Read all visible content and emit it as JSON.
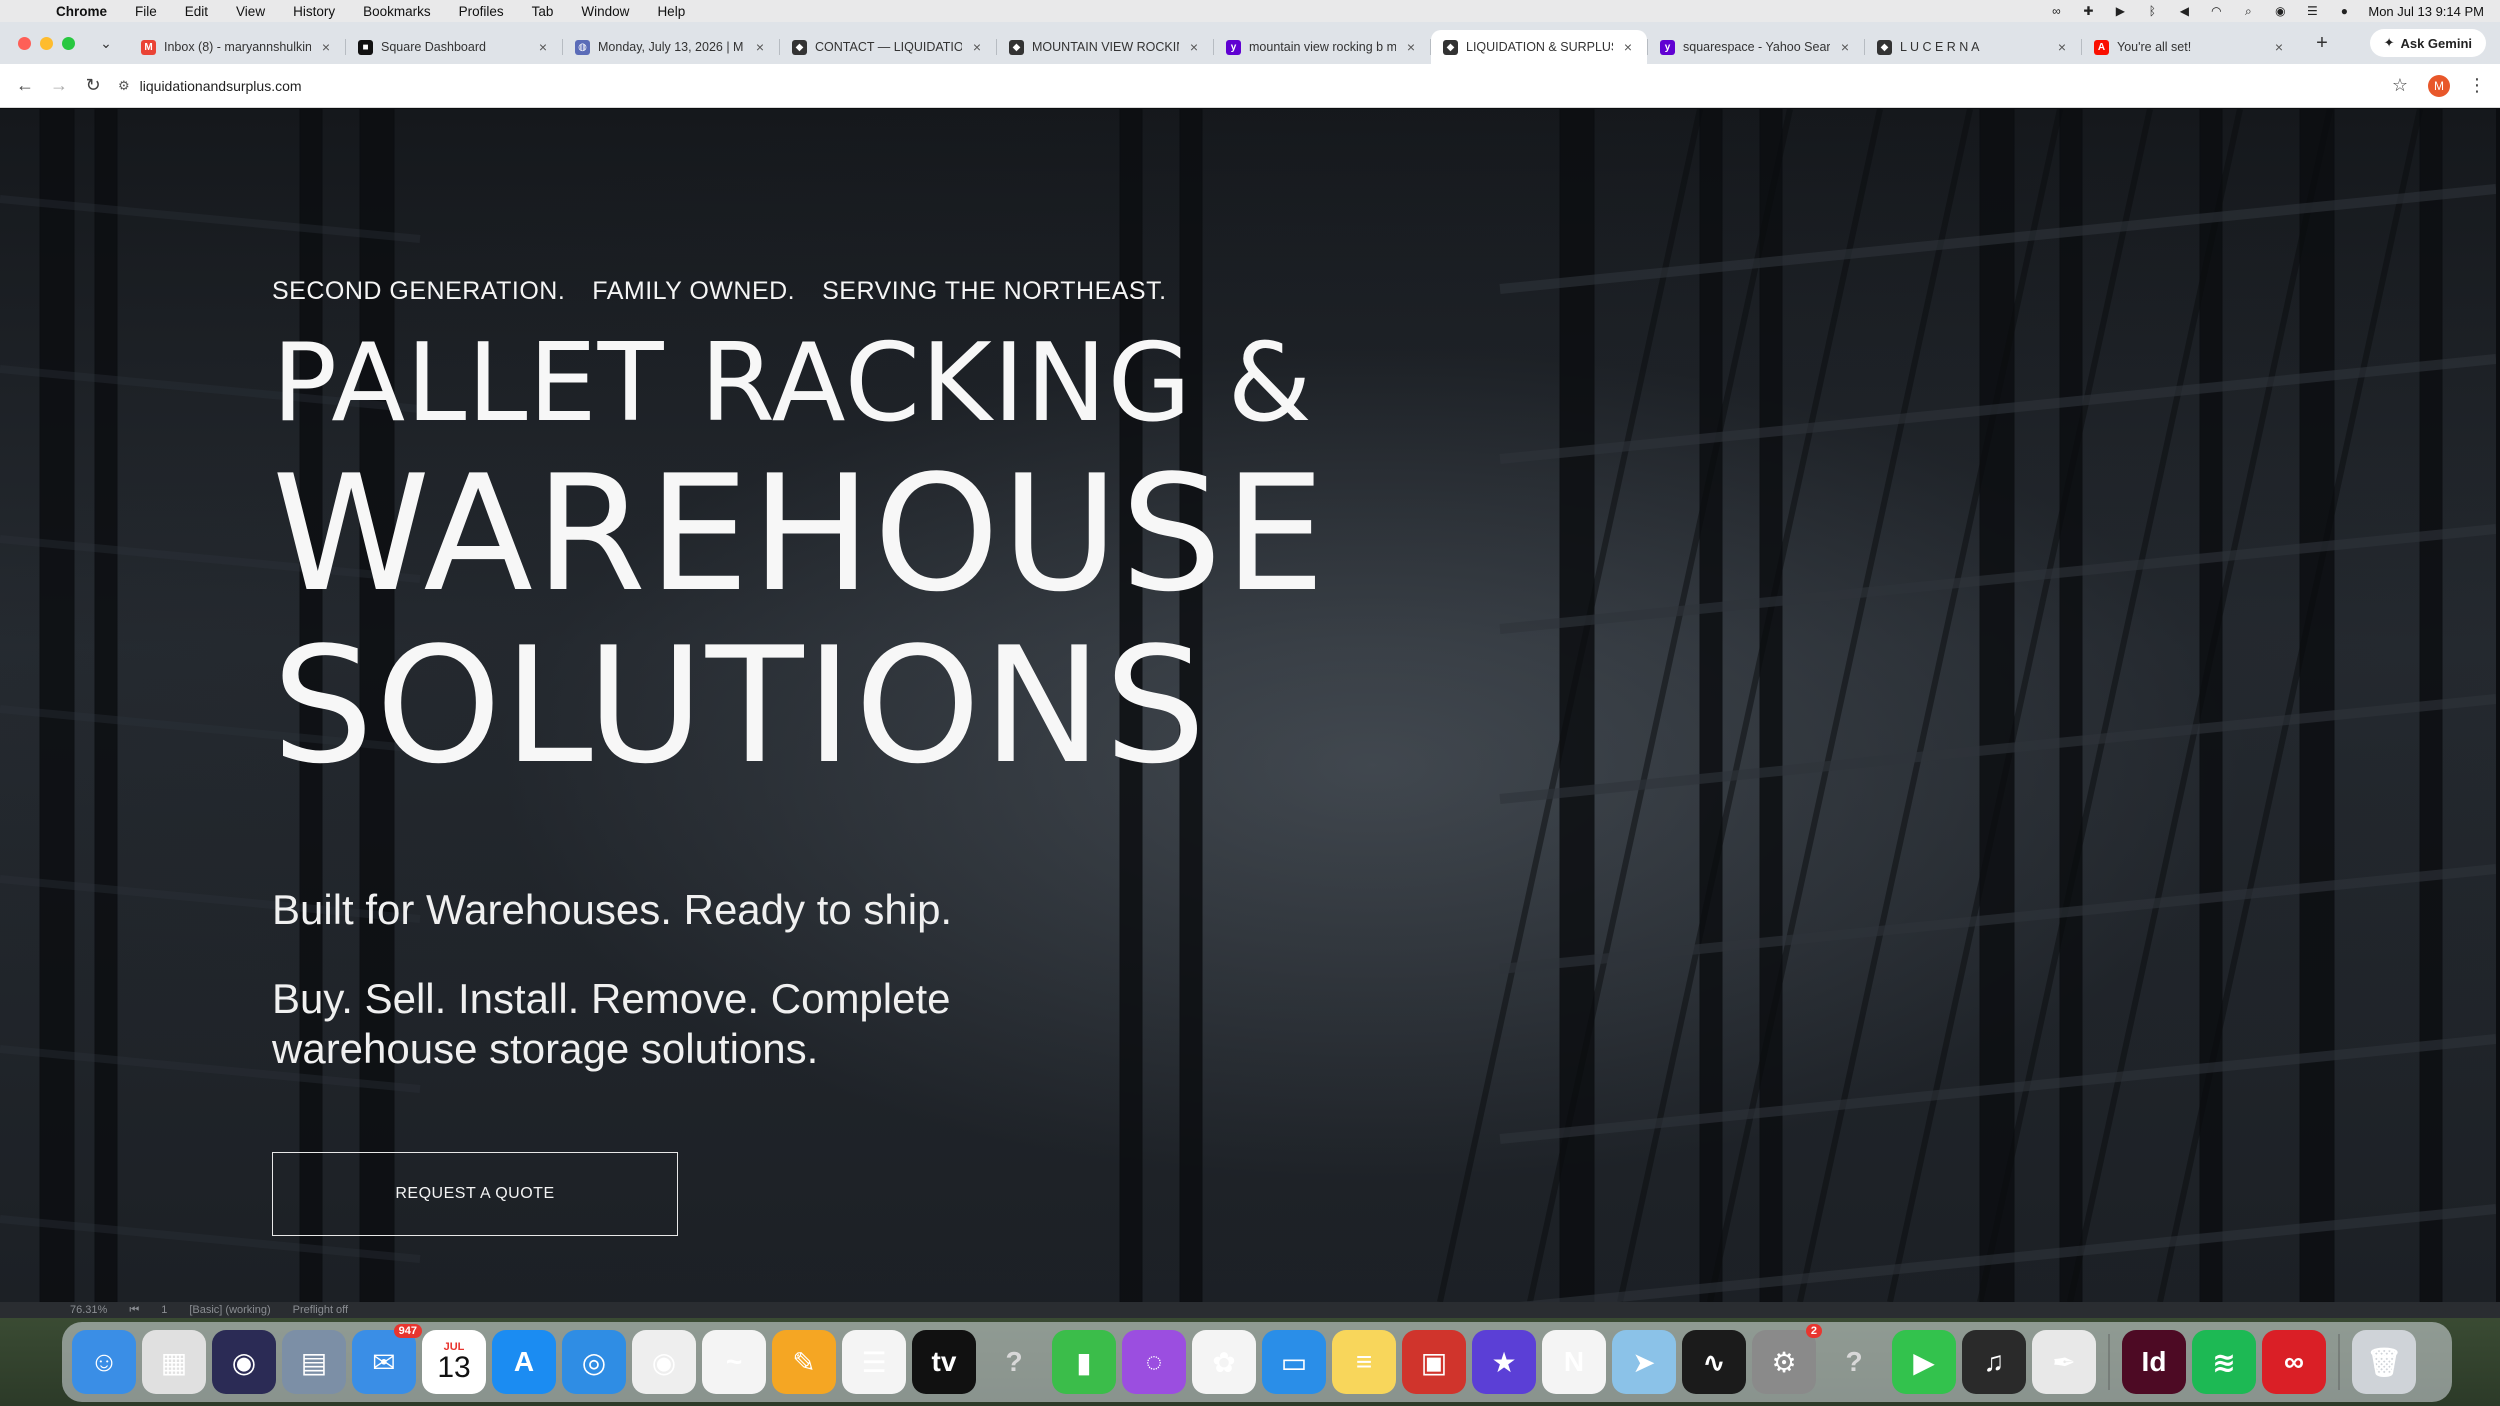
{
  "menubar": {
    "app": "Chrome",
    "items": [
      "File",
      "Edit",
      "View",
      "History",
      "Bookmarks",
      "Profiles",
      "Tab",
      "Window",
      "Help"
    ],
    "clock": "Mon Jul 13  9:14 PM"
  },
  "tabs": [
    {
      "title": "Inbox (8) - maryannshulkin",
      "favicon": "gmail-icon",
      "color": "#ea4335",
      "glyph": "M",
      "active": false
    },
    {
      "title": "Square Dashboard",
      "favicon": "square-icon",
      "color": "#111111",
      "glyph": "■",
      "active": false
    },
    {
      "title": "Monday, July 13, 2026 | M",
      "favicon": "globe-icon",
      "color": "#5b6cb8",
      "glyph": "◍",
      "active": false
    },
    {
      "title": "CONTACT — LIQUIDATION",
      "favicon": "squarespace-icon",
      "color": "#333333",
      "glyph": "◆",
      "active": false
    },
    {
      "title": "MOUNTAIN VIEW ROCKING",
      "favicon": "squarespace-icon",
      "color": "#333333",
      "glyph": "◆",
      "active": false
    },
    {
      "title": "mountain view rocking b m",
      "favicon": "yahoo-icon",
      "color": "#6001d2",
      "glyph": "y",
      "active": false
    },
    {
      "title": "LIQUIDATION & SURPLUS",
      "favicon": "squarespace-icon",
      "color": "#333333",
      "glyph": "◆",
      "active": true
    },
    {
      "title": "squarespace - Yahoo Sear",
      "favicon": "yahoo-icon",
      "color": "#6001d2",
      "glyph": "y",
      "active": false
    },
    {
      "title": "L U C E R N A",
      "favicon": "squarespace-icon",
      "color": "#333333",
      "glyph": "◆",
      "active": false
    },
    {
      "title": "You're all set!",
      "favicon": "adobe-icon",
      "color": "#fa0f00",
      "glyph": "A",
      "active": false
    }
  ],
  "toolbar": {
    "gemini": "Ask Gemini",
    "url": "liquidationandsurplus.com",
    "avatar_letter": "M"
  },
  "hero": {
    "kicker": [
      "SECOND GENERATION.",
      "FAMILY OWNED.",
      "SERVING THE NORTHEAST."
    ],
    "line1": "PALLET RACKING &",
    "line2": "WAREHOUSE",
    "line3": "SOLUTIONS",
    "sub1": "Built for Warehouses. Ready to ship.",
    "sub2": "Buy. Sell. Install. Remove. Complete warehouse storage solutions.",
    "cta": "REQUEST A QUOTE"
  },
  "appstrip": {
    "zoom": "76.31%",
    "page": "1",
    "workspace": "[Basic] (working)",
    "preflight": "Preflight off"
  },
  "dock": [
    {
      "name": "finder-icon",
      "color": "#3a8ee6",
      "glyph": "☺"
    },
    {
      "name": "launchpad-icon",
      "color": "#e0e0e0",
      "glyph": "▦"
    },
    {
      "name": "siri-icon",
      "color": "#2b2b55",
      "glyph": "◉"
    },
    {
      "name": "preview-icon",
      "color": "#7c8fa6",
      "glyph": "▤"
    },
    {
      "name": "mail-icon",
      "color": "#3a8ee6",
      "glyph": "✉",
      "badge": "947"
    },
    {
      "name": "calendar-icon",
      "color": "#ffffff",
      "glyph": "",
      "cal_month": "JUL",
      "cal_day": "13"
    },
    {
      "name": "app-store-icon",
      "color": "#1b8cf2",
      "glyph": "A"
    },
    {
      "name": "safari-icon",
      "color": "#2f8de4",
      "glyph": "◎"
    },
    {
      "name": "chrome-icon",
      "color": "#eeeeee",
      "glyph": "◉"
    },
    {
      "name": "freeform-icon",
      "color": "#f4f4f4",
      "glyph": "~"
    },
    {
      "name": "pages-icon",
      "color": "#f5a623",
      "glyph": "✎"
    },
    {
      "name": "reminders-icon",
      "color": "#f4f4f4",
      "glyph": "☰"
    },
    {
      "name": "apple-tv-icon",
      "color": "#111111",
      "glyph": "tv"
    },
    {
      "name": "unknown-app-icon",
      "color": "rgba(0,0,0,0)",
      "glyph": "?"
    },
    {
      "name": "numbers-icon",
      "color": "#3bbd4a",
      "glyph": "▮"
    },
    {
      "name": "podcasts-icon",
      "color": "#9b4ee0",
      "glyph": "◌"
    },
    {
      "name": "photos-icon",
      "color": "#f4f4f4",
      "glyph": "✿"
    },
    {
      "name": "keynote-icon",
      "color": "#2a8ee8",
      "glyph": "▭"
    },
    {
      "name": "notes-icon",
      "color": "#f8d65b",
      "glyph": "≡"
    },
    {
      "name": "photo-booth-icon",
      "color": "#d0342c",
      "glyph": "▣"
    },
    {
      "name": "imovie-icon",
      "color": "#5b3fd6",
      "glyph": "★"
    },
    {
      "name": "news-icon",
      "color": "#f4f4f4",
      "glyph": "N"
    },
    {
      "name": "maps-icon",
      "color": "#8bc2e8",
      "glyph": "➤"
    },
    {
      "name": "activity-monitor-icon",
      "color": "#1b1b1b",
      "glyph": "∿"
    },
    {
      "name": "system-settings-icon",
      "color": "#8a8a8a",
      "glyph": "⚙",
      "badge": "2"
    },
    {
      "name": "unknown-app-icon",
      "color": "rgba(0,0,0,0)",
      "glyph": "?"
    },
    {
      "name": "facetime-icon",
      "color": "#33c24d",
      "glyph": "▶"
    },
    {
      "name": "garageband-icon",
      "color": "#2a2a2a",
      "glyph": "♫"
    },
    {
      "name": "script-editor-icon",
      "color": "#e8e8e8",
      "glyph": "✒"
    },
    {
      "name": "indesign-icon",
      "color": "#4d0a24",
      "glyph": "Id",
      "sep_before": true
    },
    {
      "name": "spotify-icon",
      "color": "#1db954",
      "glyph": "≋"
    },
    {
      "name": "creative-cloud-icon",
      "color": "#da1f26",
      "glyph": "∞"
    },
    {
      "name": "trash-icon",
      "color": "#cfd3d8",
      "glyph": "🗑",
      "sep_before": true
    }
  ],
  "colors": {
    "page_bg": "#15181c",
    "hero_text": "#f5f5f5",
    "cta_border": "#e8e8e8"
  }
}
